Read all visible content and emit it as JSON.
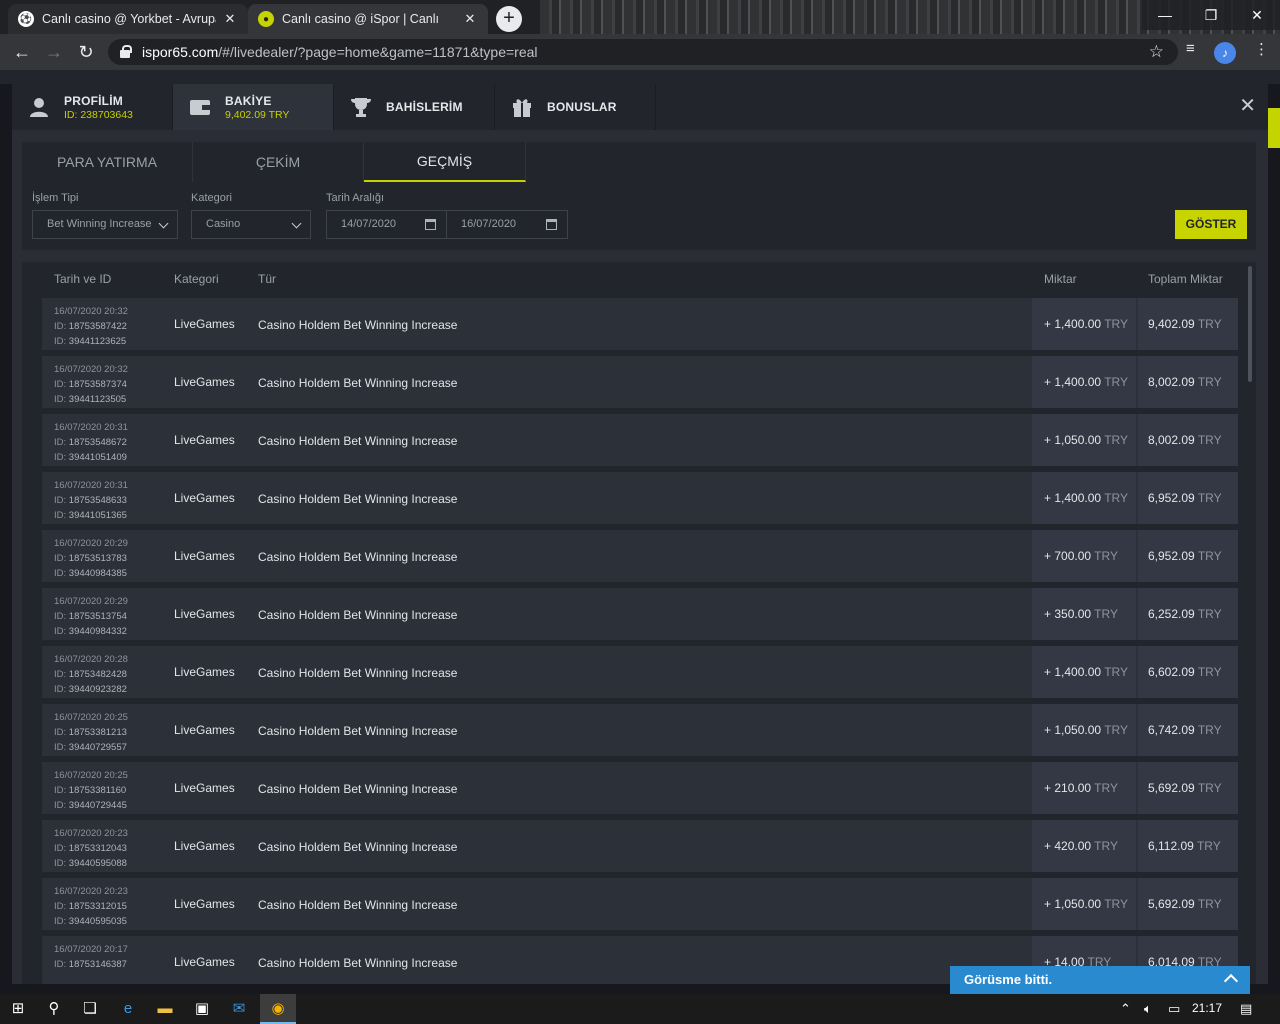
{
  "browser": {
    "tabs": [
      {
        "title": "Canlı casino @ Yorkbet - Avrupa'",
        "favicon": "soccer-ball-icon",
        "active": false
      },
      {
        "title": "Canlı casino @ iSpor | Canlı",
        "favicon": "ispor-logo-icon",
        "active": true
      }
    ],
    "url_host": "ispor65.com",
    "url_path": "/#/livedealer/?page=home&game=11871&type=real"
  },
  "modal": {
    "tabs": [
      {
        "title": "PROFİLİM",
        "sub": "ID: 238703643",
        "icon": "user-icon"
      },
      {
        "title": "BAKİYE",
        "sub": "9,402.09 TRY",
        "icon": "wallet-icon"
      },
      {
        "title": "BAHİSLERİM",
        "sub": "",
        "icon": "trophy-icon"
      },
      {
        "title": "BONUSLAR",
        "sub": "",
        "icon": "gift-icon"
      }
    ],
    "subtabs": [
      "PARA YATIRMA",
      "ÇEKİM",
      "GEÇMİŞ"
    ],
    "filters": {
      "type_label": "İşlem Tipi",
      "type_value": "Bet Winning Increase",
      "category_label": "Kategori",
      "category_value": "Casino",
      "date_label": "Tarih Aralığı",
      "date_from": "14/07/2020",
      "date_to": "16/07/2020",
      "show_button": "GÖSTER"
    },
    "table": {
      "headers": {
        "date_id": "Tarih ve ID",
        "category": "Kategori",
        "type": "Tür",
        "amount": "Miktar",
        "total": "Toplam Miktar"
      },
      "currency": "TRY",
      "rows": [
        {
          "date": "16/07/2020 20:32",
          "id1": "18753587422",
          "id2": "39441123625",
          "category": "LiveGames",
          "type": "Casino Holdem Bet Winning Increase",
          "amount": "+ 1,400.00",
          "total": "9,402.09"
        },
        {
          "date": "16/07/2020 20:32",
          "id1": "18753587374",
          "id2": "39441123505",
          "category": "LiveGames",
          "type": "Casino Holdem Bet Winning Increase",
          "amount": "+ 1,400.00",
          "total": "8,002.09"
        },
        {
          "date": "16/07/2020 20:31",
          "id1": "18753548672",
          "id2": "39441051409",
          "category": "LiveGames",
          "type": "Casino Holdem Bet Winning Increase",
          "amount": "+ 1,050.00",
          "total": "8,002.09"
        },
        {
          "date": "16/07/2020 20:31",
          "id1": "18753548633",
          "id2": "39441051365",
          "category": "LiveGames",
          "type": "Casino Holdem Bet Winning Increase",
          "amount": "+ 1,400.00",
          "total": "6,952.09"
        },
        {
          "date": "16/07/2020 20:29",
          "id1": "18753513783",
          "id2": "39440984385",
          "category": "LiveGames",
          "type": "Casino Holdem Bet Winning Increase",
          "amount": "+ 700.00",
          "total": "6,952.09"
        },
        {
          "date": "16/07/2020 20:29",
          "id1": "18753513754",
          "id2": "39440984332",
          "category": "LiveGames",
          "type": "Casino Holdem Bet Winning Increase",
          "amount": "+ 350.00",
          "total": "6,252.09"
        },
        {
          "date": "16/07/2020 20:28",
          "id1": "18753482428",
          "id2": "39440923282",
          "category": "LiveGames",
          "type": "Casino Holdem Bet Winning Increase",
          "amount": "+ 1,400.00",
          "total": "6,602.09"
        },
        {
          "date": "16/07/2020 20:25",
          "id1": "18753381213",
          "id2": "39440729557",
          "category": "LiveGames",
          "type": "Casino Holdem Bet Winning Increase",
          "amount": "+ 1,050.00",
          "total": "6,742.09"
        },
        {
          "date": "16/07/2020 20:25",
          "id1": "18753381160",
          "id2": "39440729445",
          "category": "LiveGames",
          "type": "Casino Holdem Bet Winning Increase",
          "amount": "+ 210.00",
          "total": "5,692.09"
        },
        {
          "date": "16/07/2020 20:23",
          "id1": "18753312043",
          "id2": "39440595088",
          "category": "LiveGames",
          "type": "Casino Holdem Bet Winning Increase",
          "amount": "+ 420.00",
          "total": "6,112.09"
        },
        {
          "date": "16/07/2020 20:23",
          "id1": "18753312015",
          "id2": "39440595035",
          "category": "LiveGames",
          "type": "Casino Holdem Bet Winning Increase",
          "amount": "+ 1,050.00",
          "total": "5,692.09"
        },
        {
          "date": "16/07/2020 20:17",
          "id1": "18753146387",
          "id2": "",
          "category": "LiveGames",
          "type": "Casino Holdem Bet Winning Increase",
          "amount": "+ 14.00",
          "total": "6,014.09"
        }
      ]
    }
  },
  "chat": {
    "label": "Görüsme bitti."
  },
  "taskbar": {
    "time": "21:17"
  },
  "colors": {
    "accent": "#c7d400",
    "chat": "#2a8ad0"
  }
}
